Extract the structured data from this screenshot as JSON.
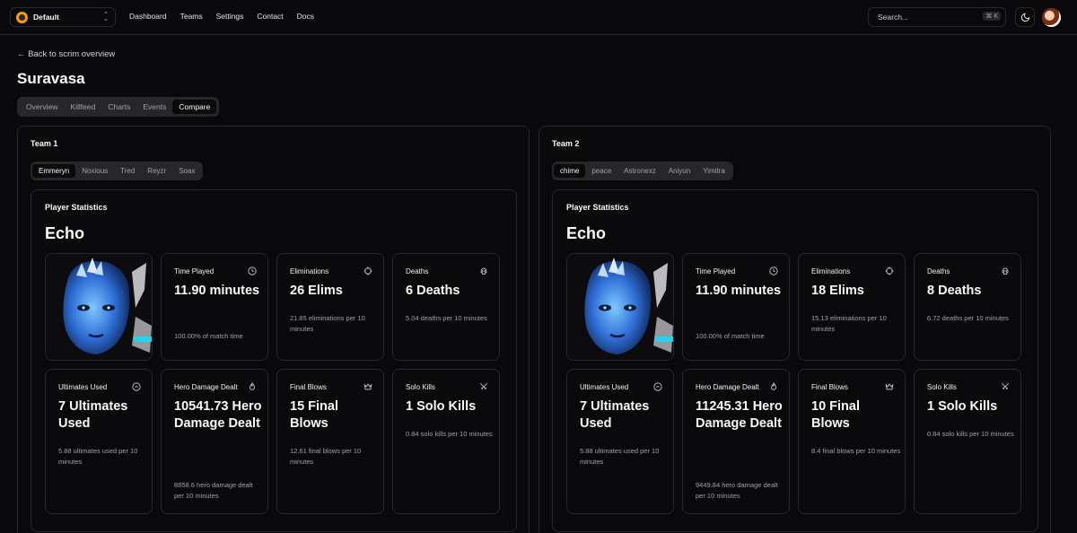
{
  "nav": {
    "team_switcher": "Default",
    "links": [
      "Dashboard",
      "Teams",
      "Settings",
      "Contact",
      "Docs"
    ],
    "search_placeholder": "Search...",
    "search_shortcut": "⌘ K"
  },
  "header": {
    "back_link": "← Back to scrim overview",
    "title": "Suravasa",
    "tabs": [
      "Overview",
      "Killfeed",
      "Charts",
      "Events",
      "Compare"
    ],
    "active_tab": "Compare"
  },
  "icons": {
    "time_played": "clock-icon",
    "eliminations": "crosshair-icon",
    "deaths": "skull-icon",
    "ultimates_used": "gauge-icon",
    "hero_damage": "flame-icon",
    "final_blows": "crown-icon",
    "solo_kills": "swords-icon"
  },
  "teams": [
    {
      "name": "Team 1",
      "players": [
        "Emmeryn",
        "Noxious",
        "Tred",
        "Reyzr",
        "Soax"
      ],
      "active_player": "Emmeryn",
      "section_title": "Player Statistics",
      "hero": "Echo",
      "stats": {
        "time_played": {
          "label": "Time Played",
          "value": "11.90 minutes",
          "sub": "100.00% of match time"
        },
        "eliminations": {
          "label": "Eliminations",
          "value": "26 Elims",
          "sub": "21.85 eliminations per 10 minutes"
        },
        "deaths": {
          "label": "Deaths",
          "value": "6 Deaths",
          "sub": "5.04 deaths per 10 minutes"
        },
        "ultimates_used": {
          "label": "Ultimates Used",
          "value": "7 Ultimates Used",
          "sub": "5.88 ultimates used per 10 minutes"
        },
        "hero_damage": {
          "label": "Hero Damage Dealt",
          "value": "10541.73 Hero Damage Dealt",
          "sub": "8858.6 hero damage dealt per 10 minutes"
        },
        "final_blows": {
          "label": "Final Blows",
          "value": "15 Final Blows",
          "sub": "12.61 final blows per 10 minutes"
        },
        "solo_kills": {
          "label": "Solo Kills",
          "value": "1 Solo Kills",
          "sub": "0.84 solo kills per 10 minutes"
        }
      }
    },
    {
      "name": "Team 2",
      "players": [
        "chime",
        "peace",
        "Astronexz",
        "Aniyun",
        "Yimitra"
      ],
      "active_player": "chime",
      "section_title": "Player Statistics",
      "hero": "Echo",
      "stats": {
        "time_played": {
          "label": "Time Played",
          "value": "11.90 minutes",
          "sub": "100.00% of match time"
        },
        "eliminations": {
          "label": "Eliminations",
          "value": "18 Elims",
          "sub": "15.13 eliminations per 10 minutes"
        },
        "deaths": {
          "label": "Deaths",
          "value": "8 Deaths",
          "sub": "6.72 deaths per 10 minutes"
        },
        "ultimates_used": {
          "label": "Ultimates Used",
          "value": "7 Ultimates Used",
          "sub": "5.88 ultimates used per 10 minutes"
        },
        "hero_damage": {
          "label": "Hero Damage Dealt",
          "value": "11245.31 Hero Damage Dealt",
          "sub": "9449.84 hero damage dealt per 10 minutes"
        },
        "final_blows": {
          "label": "Final Blows",
          "value": "10 Final Blows",
          "sub": "8.4 final blows per 10 minutes"
        },
        "solo_kills": {
          "label": "Solo Kills",
          "value": "1 Solo Kills",
          "sub": "0.84 solo kills per 10 minutes"
        }
      }
    }
  ]
}
